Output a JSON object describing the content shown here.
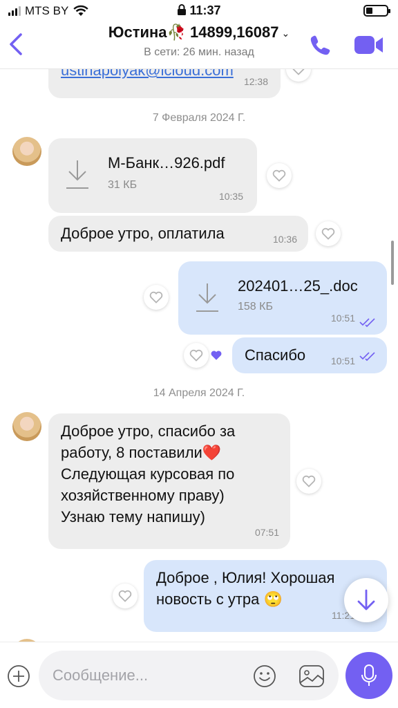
{
  "status_bar": {
    "carrier": "MTS BY",
    "time": "11:37"
  },
  "header": {
    "contact_name": "Юстина🥀 14899,16087",
    "presence": "В сети: 26 мин. назад"
  },
  "messages": {
    "partial_email": "ustinapolyak@icloud.com",
    "partial_email_time": "12:38",
    "date_1": "7 Февраля 2024 Г.",
    "file_1": {
      "name": "М-Банк…926.pdf",
      "size": "31 КБ",
      "time": "10:35"
    },
    "msg_1": {
      "text": "Доброе утро, оплатила",
      "time": "10:36"
    },
    "file_2": {
      "name": "202401…25_.doc",
      "size": "158 КБ",
      "time": "10:51"
    },
    "msg_2": {
      "text": "Спасибо",
      "time": "10:51"
    },
    "date_2": "14 Апреля 2024 Г.",
    "msg_3": {
      "lines": [
        "Доброе утро, спасибо за",
        "работу, 8 поставили❤️",
        "Следующая курсовая по",
        "хозяйственному праву)",
        "Узнаю тему напишу)"
      ],
      "time": "07:51"
    },
    "msg_4": {
      "lines": [
        "Доброе , Юлия! Хорошая",
        "новость с утра 🙄"
      ],
      "time": "11:21"
    }
  },
  "composer": {
    "placeholder": "Сообщение..."
  },
  "colors": {
    "accent": "#7360f2",
    "incoming": "#ededed",
    "outgoing": "#d8e6fb",
    "read_ticks": "#7360f2"
  }
}
